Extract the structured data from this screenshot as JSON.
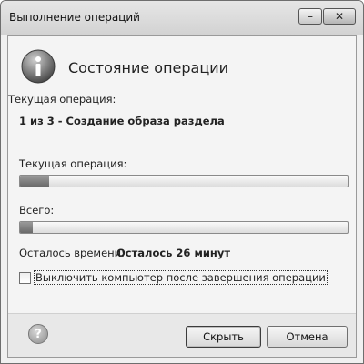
{
  "window": {
    "title": "Выполнение операций",
    "minimize_glyph": "–",
    "close_glyph": "✕"
  },
  "header": {
    "icon": "info-icon",
    "title": "Состояние операции"
  },
  "current_operation": {
    "label": "Текущая операция:",
    "value": "1 из 3 - Создание образа раздела"
  },
  "progress_current": {
    "label": "Текущая операция:",
    "percent": 9
  },
  "progress_total": {
    "label": "Всего:",
    "percent": 4
  },
  "time_left": {
    "label": "Осталось времени:",
    "value": "Осталось 26 минут"
  },
  "shutdown_option": {
    "label": "Выключить компьютер после завершения операции",
    "checked": false
  },
  "footer": {
    "help_glyph": "?",
    "hide_label": "Скрыть",
    "cancel_label": "Отмена"
  }
}
